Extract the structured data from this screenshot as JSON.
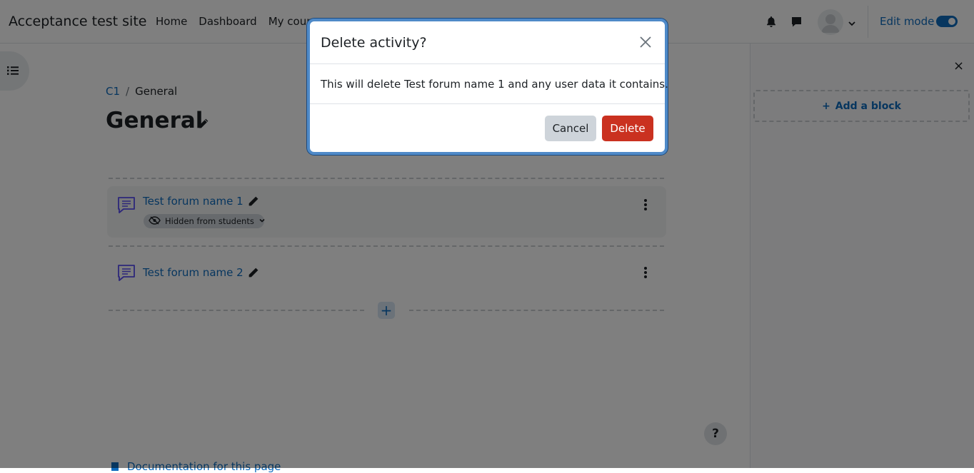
{
  "navbar": {
    "brand": "Acceptance test site",
    "links": [
      "Home",
      "Dashboard",
      "My courses"
    ],
    "edit_mode_label": "Edit mode",
    "edit_mode_on": true
  },
  "breadcrumb": {
    "items": [
      "C1",
      "General"
    ]
  },
  "page": {
    "title": "General"
  },
  "activities": [
    {
      "name": "Test forum name 1",
      "badge": "Hidden from students"
    },
    {
      "name": "Test forum name 2"
    }
  ],
  "add_activity_label": "+",
  "block_drawer": {
    "close": "×",
    "add_block_label": "Add a block"
  },
  "help_label": "?",
  "footer": {
    "doc_link": "Documentation for this page"
  },
  "modal": {
    "title": "Delete activity?",
    "body": "This will delete Test forum name 1 and any user data it contains.",
    "cancel_label": "Cancel",
    "delete_label": "Delete"
  },
  "colors": {
    "link": "#0f6cbf",
    "danger": "#ca3120",
    "forum_icon": "#5b4ff5"
  },
  "icons": [
    "bell-icon",
    "chat-icon",
    "avatar",
    "chevron-down-icon",
    "list-icon",
    "pencil-icon",
    "forum-icon",
    "eye-slash-icon",
    "kebab-menu-icon",
    "close-icon",
    "plus-icon",
    "help-icon"
  ]
}
